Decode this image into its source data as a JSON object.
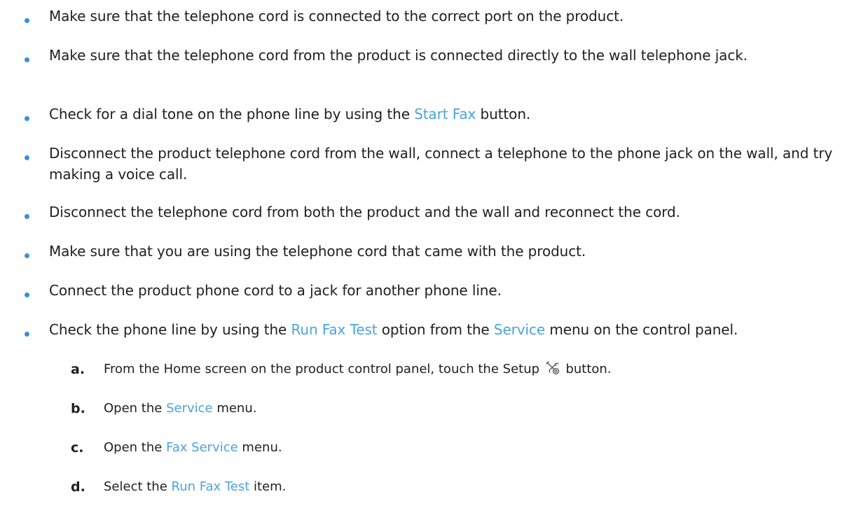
{
  "bullets": [
    {
      "text": "Make sure that the telephone cord is connected to the correct port on the product."
    },
    {
      "text": "Make sure that the telephone cord from the product is connected directly to the wall telephone jack."
    },
    {
      "before": "Check for a dial tone on the phone line by using the ",
      "link": "Start Fax",
      "after": " button."
    },
    {
      "text": "Disconnect the product telephone cord from the wall, connect a telephone to the phone jack on the wall, and try making a voice call."
    },
    {
      "text": "Disconnect the telephone cord from both the product and the wall and reconnect the cord."
    },
    {
      "text": "Make sure that you are using the telephone cord that came with the product."
    },
    {
      "text": "Connect the product phone cord to a jack for another phone line."
    },
    {
      "before": "Check the phone line by using the ",
      "link1": "Run Fax Test",
      "middle": " option from the ",
      "link2": "Service",
      "after": " menu on the control panel."
    }
  ],
  "steps": [
    {
      "label": "a.",
      "before": "From the Home screen on the product control panel, touch the Setup ",
      "after": " button.",
      "icon": "setup-wrench-screwdriver-icon"
    },
    {
      "label": "b.",
      "before": "Open the ",
      "link": "Service",
      "after": " menu."
    },
    {
      "label": "c.",
      "before": "Open the ",
      "link": "Fax Service",
      "after": " menu."
    },
    {
      "label": "d.",
      "before": "Select the ",
      "link": "Run Fax Test",
      "after": " item."
    }
  ],
  "colors": {
    "link": "#4aa3df",
    "bullet": "#3b8ed8",
    "text": "#1f1f1f"
  }
}
